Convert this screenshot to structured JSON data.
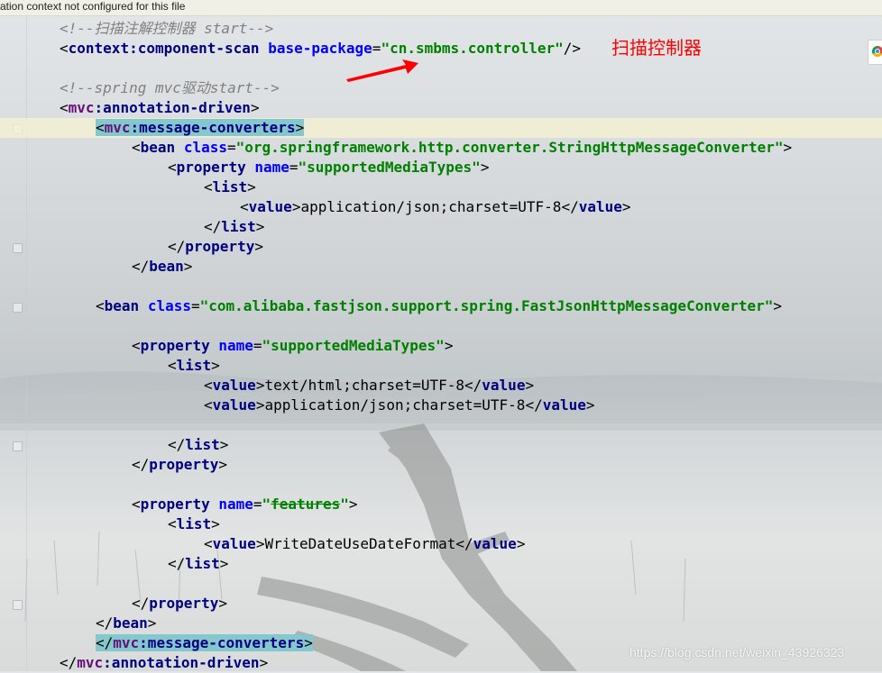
{
  "notice": "ation context not configured for this file",
  "annotation": "扫描控制器",
  "watermark": "https://blog.csdn.net/weixin_43926323",
  "code": {
    "l1": {
      "comment": "<!--扫描注解控制器 start-->"
    },
    "l2": {
      "tag": "context:component-scan",
      "attr": "base-package",
      "value": "\"cn.smbms.controller\""
    },
    "l4": {
      "comment": "<!--spring mvc驱动start-->"
    },
    "l5": {
      "ns": "mvc",
      "tag": ":annotation-driven"
    },
    "l6": {
      "ns": "mvc",
      "tag": ":message-converters"
    },
    "l7": {
      "tag": "bean",
      "attr": "class",
      "value": "\"org.springframework.http.converter.StringHttpMessageConverter\""
    },
    "l8": {
      "tag": "property",
      "attr": "name",
      "value": "\"supportedMediaTypes\""
    },
    "l9": {
      "tag": "list"
    },
    "l10": {
      "tag": "value",
      "text": "application/json;charset=UTF-8",
      "close": "value"
    },
    "l11": {
      "tag": "list"
    },
    "l12": {
      "tag": "property"
    },
    "l13": {
      "tag": "bean"
    },
    "l15": {
      "tag": "bean",
      "attr": "class",
      "value": "\"com.alibaba.fastjson.support.spring.FastJsonHttpMessageConverter\""
    },
    "l17": {
      "tag": "property",
      "attr": "name",
      "value": "\"supportedMediaTypes\""
    },
    "l18": {
      "tag": "list"
    },
    "l19": {
      "tag": "value",
      "text": "text/html;charset=UTF-8",
      "close": "value"
    },
    "l20": {
      "tag": "value",
      "text": "application/json;charset=UTF-8",
      "close": "value"
    },
    "l22": {
      "tag": "list"
    },
    "l23": {
      "tag": "property"
    },
    "l25": {
      "tag": "property",
      "attr": "name",
      "value_q": "\"",
      "value_strike": "features"
    },
    "l26": {
      "tag": "list"
    },
    "l27": {
      "tag": "value",
      "text": "WriteDateUseDateFormat",
      "close": "value"
    },
    "l28": {
      "tag": "list"
    },
    "l30": {
      "tag": "property"
    },
    "l31": {
      "tag": "bean"
    },
    "l32": {
      "ns": "mvc",
      "tag": ":message-converters"
    },
    "l33": {
      "ns": "mvc",
      "tag": ":annotation-driven"
    }
  },
  "colors": {
    "annotation": "#ff0000",
    "tag": "#000080",
    "string": "#008000",
    "attribute": "#0000ff",
    "comment": "#808080"
  }
}
